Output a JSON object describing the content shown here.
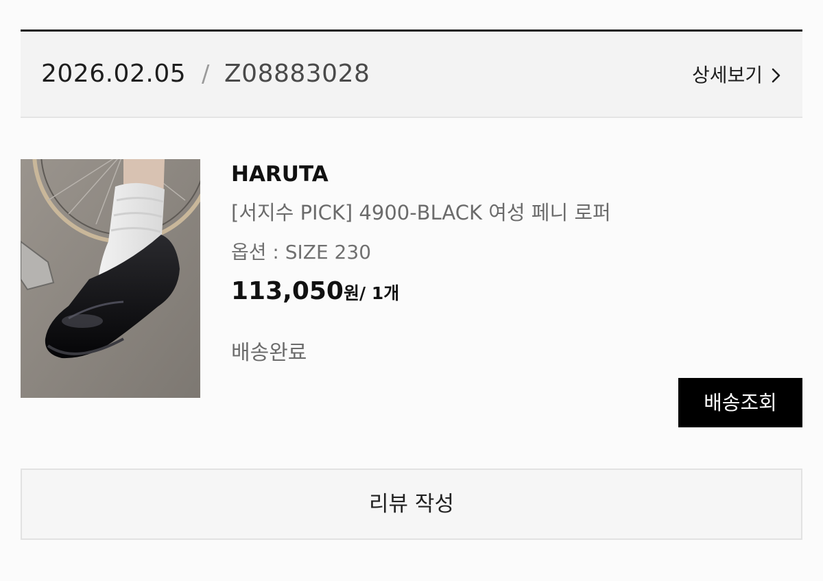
{
  "order": {
    "date": "2026.02.05",
    "separator": "/",
    "number": "Z08883028",
    "detail_label": "상세보기"
  },
  "item": {
    "thumbnail_icon": "product-photo-black-penny-loafer",
    "brand": "HARUTA",
    "name": "[서지수 PICK] 4900-BLACK 여성 페니 로퍼",
    "option": "옵션 : SIZE 230",
    "price": "113,050",
    "price_unit": "원",
    "quantity": "/ 1개",
    "status": "배송완료",
    "track_button": "배송조회"
  },
  "review_button": "리뷰 작성",
  "colors": {
    "accent": "#000000",
    "header_bg": "#f3f3f3",
    "page_bg": "#fbfbfb"
  }
}
